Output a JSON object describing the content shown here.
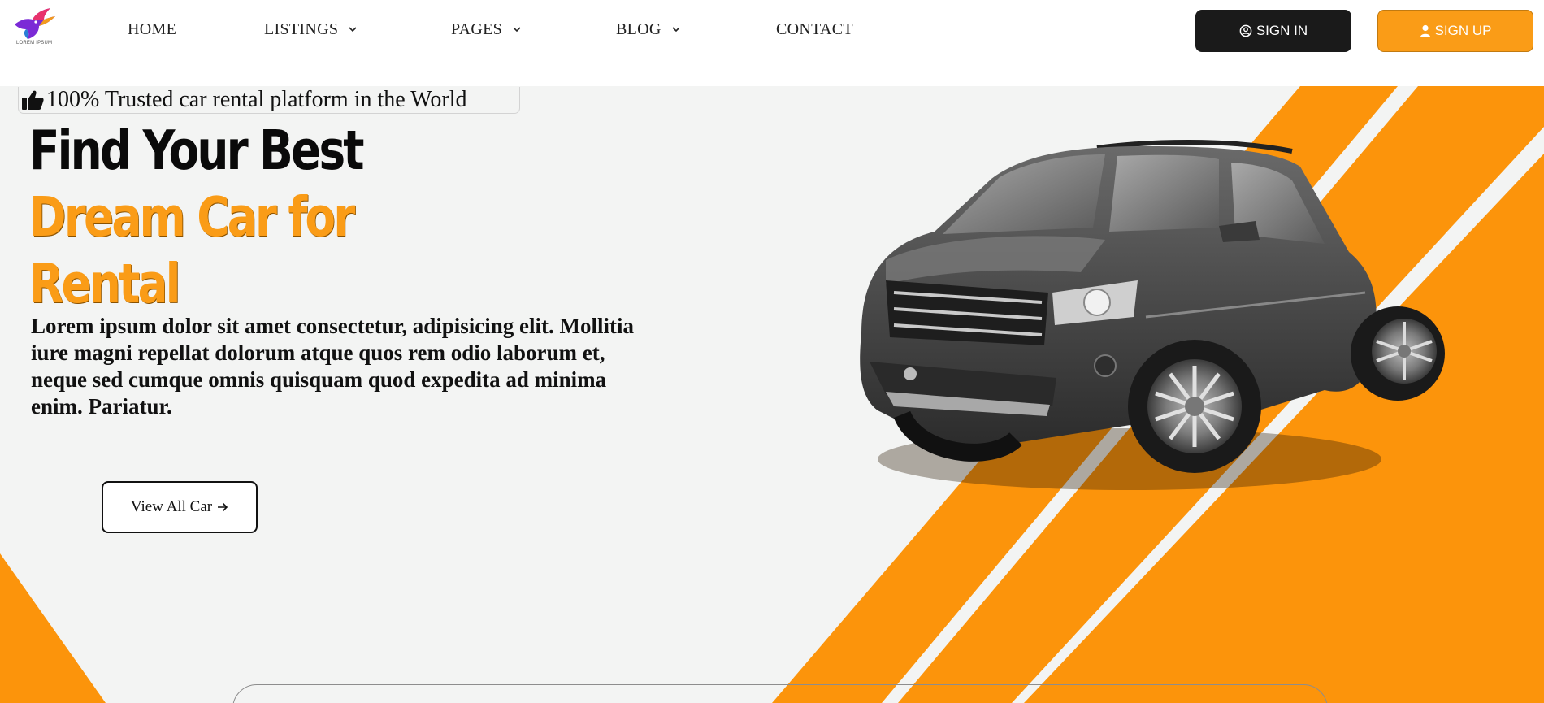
{
  "brand": {
    "logo_text": "LOREM IPSUM"
  },
  "nav": {
    "items": [
      {
        "label": "HOME",
        "has_dropdown": false
      },
      {
        "label": "LISTINGS",
        "has_dropdown": true
      },
      {
        "label": "PAGES",
        "has_dropdown": true
      },
      {
        "label": "BLOG",
        "has_dropdown": true
      },
      {
        "label": "CONTACT",
        "has_dropdown": false
      }
    ]
  },
  "auth": {
    "signin_label": "SIGN IN",
    "signup_label": "SIGN UP"
  },
  "hero": {
    "badge_text": "100% Trusted car rental platform in the World",
    "headline_line1": "Find Your Best",
    "headline_line2": "Dream Car for",
    "headline_line3": "Rental",
    "description": "Lorem ipsum dolor sit amet consectetur, adipisicing elit. Mollitia iure magni repellat dolorum atque quos rem odio laborum et, neque sed cumque omnis quisquam quod expedita ad minima enim. Pariatur.",
    "cta_label": "View All Car"
  },
  "colors": {
    "accent": "#fa9c17",
    "dark": "#1a1a1a",
    "background": "#f3f4f3"
  },
  "icons": [
    "logo-bird-icon",
    "chevron-down-icon",
    "user-circle-icon",
    "user-icon",
    "thumbs-up-icon",
    "arrow-right-icon"
  ]
}
